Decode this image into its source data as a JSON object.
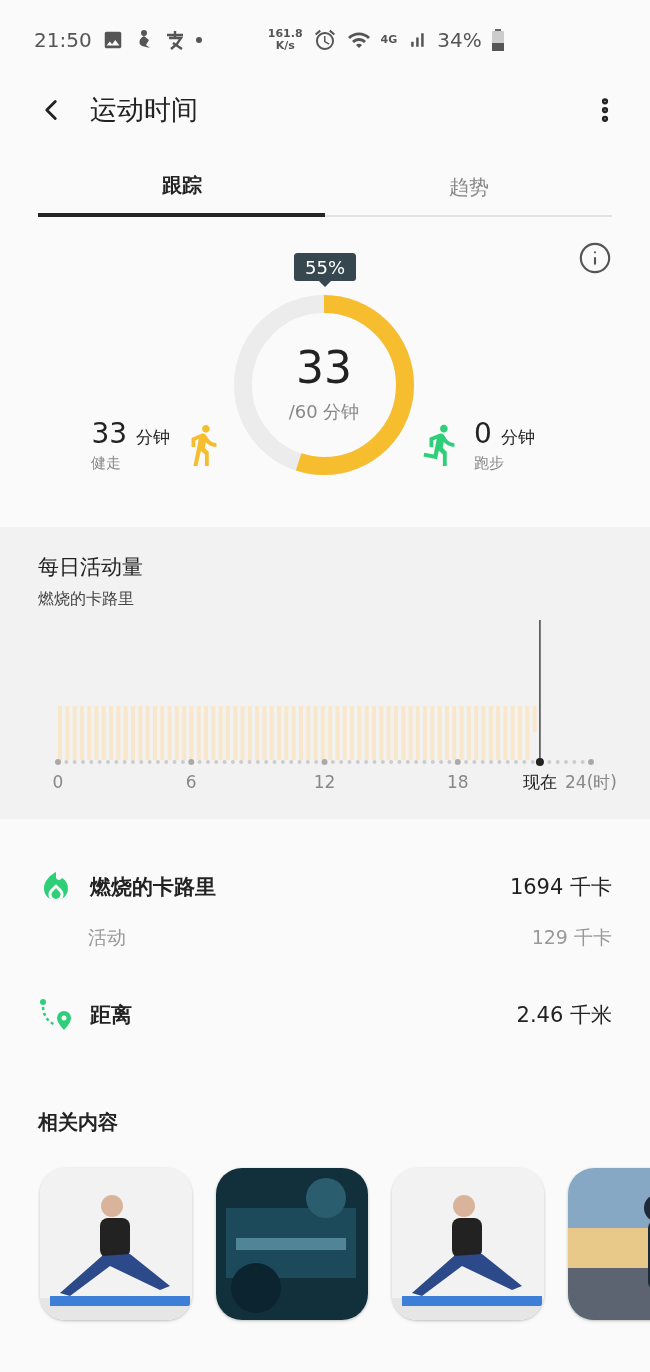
{
  "status_bar": {
    "time": "21:50",
    "net_speed": "161.8",
    "net_unit": "K/s",
    "network": "4G",
    "battery": "34%"
  },
  "header": {
    "title": "运动时间"
  },
  "tabs": [
    {
      "label": "跟踪",
      "selected": true
    },
    {
      "label": "趋势",
      "selected": false
    }
  ],
  "goal": {
    "percent": "55%",
    "level": 0.55,
    "value": "33",
    "target": "/60 分钟"
  },
  "activities": [
    {
      "kind": "walk",
      "value": "33",
      "unit": "分钟",
      "label": "健走"
    },
    {
      "kind": "run",
      "value": "0",
      "unit": "分钟",
      "label": "跑步"
    }
  ],
  "daily": {
    "title": "每日活动量",
    "subtitle": "燃烧的卡路里",
    "ticks": [
      "0",
      "6",
      "12",
      "18"
    ],
    "now": "现在",
    "end": "24(时)"
  },
  "stats": [
    {
      "kind": "calories",
      "label": "燃烧的卡路里",
      "value": "1694 千卡",
      "sub_label": "活动",
      "sub_value": "129 千卡"
    },
    {
      "kind": "distance",
      "label": "距离",
      "value": "2.46 千米"
    }
  ],
  "related": {
    "title": "相关内容"
  }
}
